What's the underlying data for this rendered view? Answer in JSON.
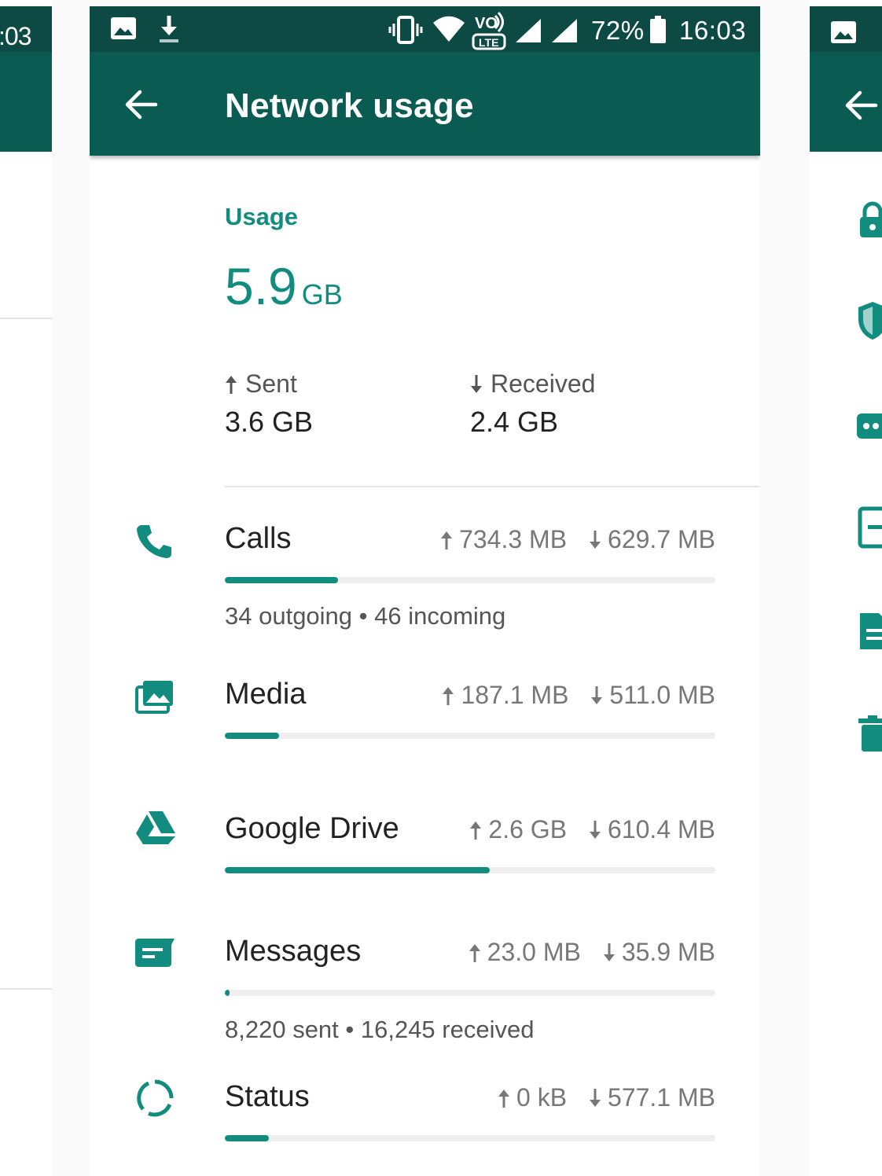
{
  "left_panel": {
    "time": ":03"
  },
  "status_bar": {
    "battery": "72%",
    "time": "16:03"
  },
  "toolbar": {
    "title": "Network usage"
  },
  "usage": {
    "label": "Usage",
    "total_value": "5.9",
    "total_unit": "GB",
    "sent_label": "Sent",
    "sent_value": "3.6 GB",
    "received_label": "Received",
    "received_value": "2.4 GB"
  },
  "rows": [
    {
      "label": "Calls",
      "sent": "734.3 MB",
      "received": "629.7 MB",
      "progress": 0.23,
      "detail": "34 outgoing • 46 incoming"
    },
    {
      "label": "Media",
      "sent": "187.1 MB",
      "received": "511.0 MB",
      "progress": 0.11
    },
    {
      "label": "Google Drive",
      "sent": "2.6 GB",
      "received": "610.4 MB",
      "progress": 0.54
    },
    {
      "label": "Messages",
      "sent": "23.0 MB",
      "received": "35.9 MB",
      "progress": 0.01,
      "detail": "8,220 sent • 16,245 received"
    },
    {
      "label": "Status",
      "sent": "0 kB",
      "received": "577.1 MB",
      "progress": 0.09
    }
  ],
  "colors": {
    "accent": "#128c7e",
    "toolbar": "#0a5c52",
    "statusbar": "#0d4a44"
  },
  "icons": [
    "back-arrow-icon",
    "phone-icon",
    "media-icon",
    "google-drive-icon",
    "message-icon",
    "status-icon",
    "lock-icon",
    "shield-icon",
    "dots-icon",
    "document-icon",
    "trash-icon"
  ]
}
